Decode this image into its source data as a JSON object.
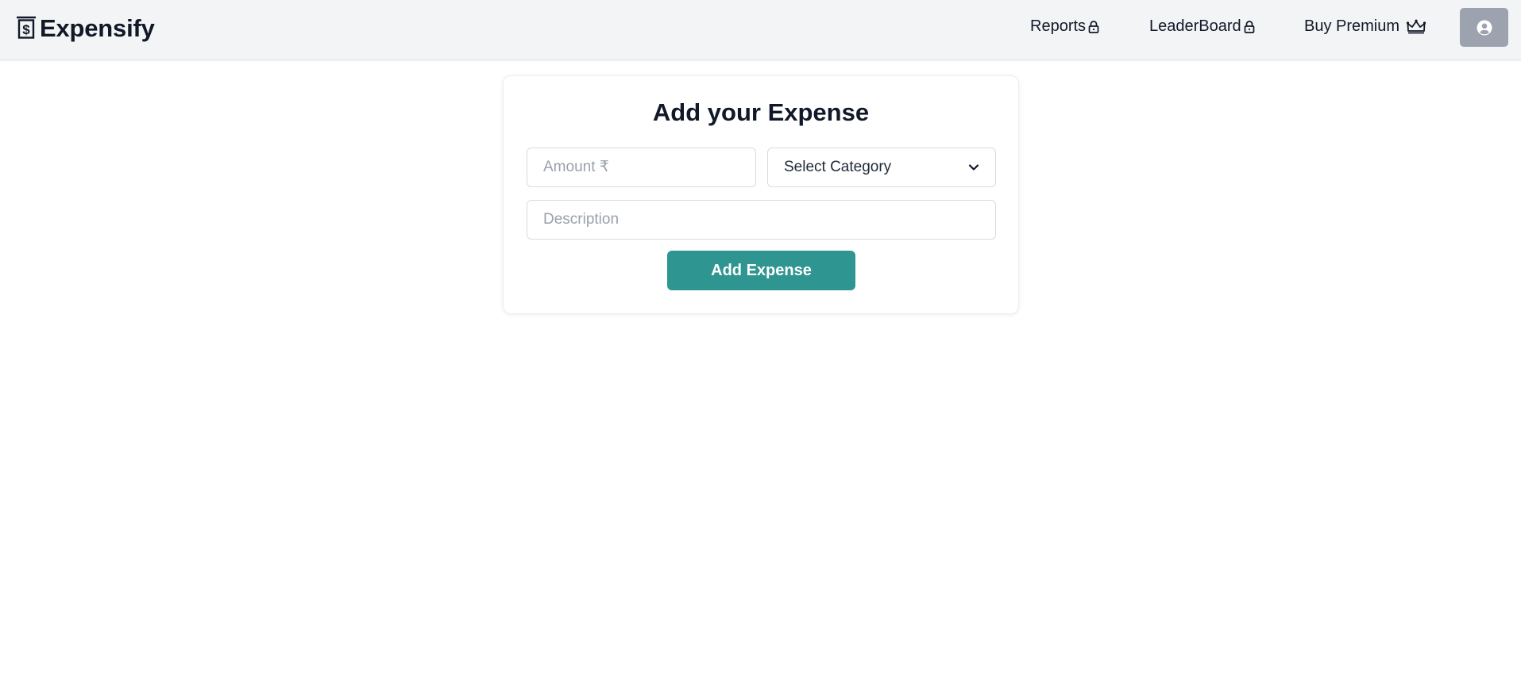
{
  "brand": {
    "name": "Expensify",
    "icon": "dollar-document-icon"
  },
  "nav": {
    "reports": {
      "label": "Reports",
      "icon": "lock-icon"
    },
    "leaderboard": {
      "label": "LeaderBoard",
      "icon": "lock-icon"
    },
    "premium": {
      "label": "Buy Premium",
      "icon": "crown-icon"
    },
    "profile": {
      "icon": "user-circle-icon"
    }
  },
  "form": {
    "title": "Add your Expense",
    "amount_placeholder": "Amount ₹",
    "amount_value": "",
    "category_selected": "Select Category",
    "description_placeholder": "Description",
    "description_value": "",
    "submit_label": "Add Expense"
  },
  "colors": {
    "navbar_bg": "#f3f4f6",
    "accent": "#2f9590",
    "profile_button": "#9ca3af"
  }
}
